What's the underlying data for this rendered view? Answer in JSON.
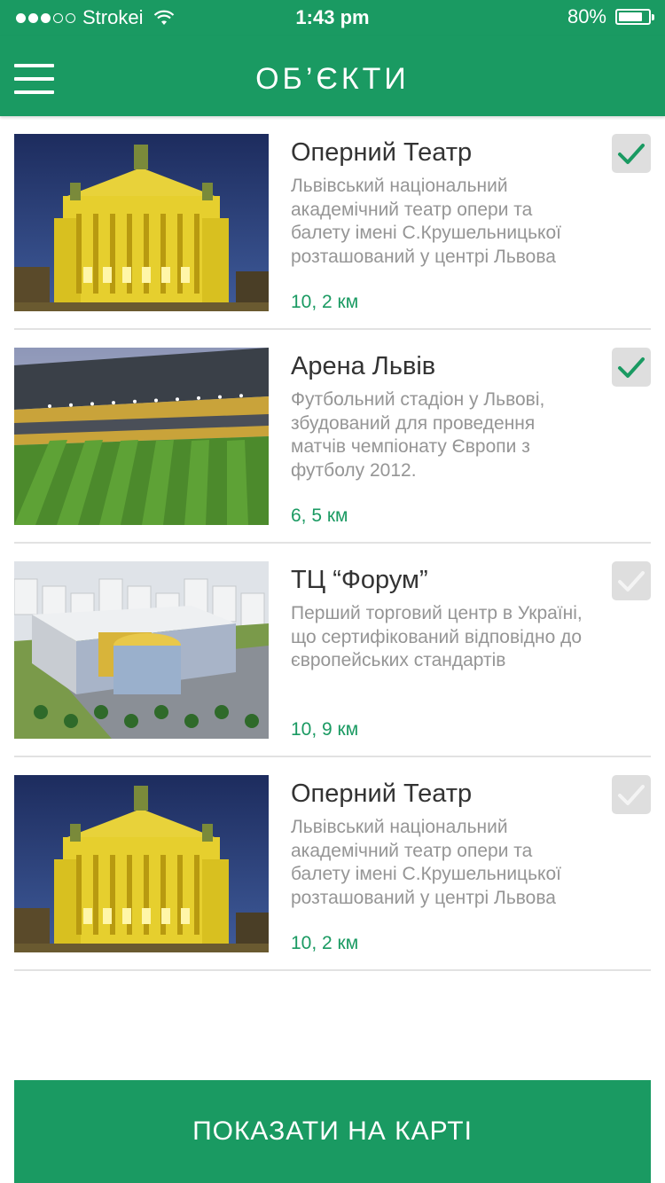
{
  "status": {
    "carrier": "Strokei",
    "time": "1:43 pm",
    "battery": "80%",
    "battery_level": 0.8,
    "signal_bars": 3,
    "signal_total": 5
  },
  "header": {
    "title": "ОБ’ЄКТИ"
  },
  "items": [
    {
      "title": "Оперний Театр",
      "description": "Львівський національний академічний театр опери та балету імені С.Крушельницької розташований у центрі Львова",
      "distance": "10, 2 км",
      "checked": true,
      "image": "opera-theatre"
    },
    {
      "title": "Арена Львів",
      "description": "Футбольний стадіон у Львові, збудований для проведення матчів чемпіонату Європи з футболу 2012.",
      "distance": "6, 5 км",
      "checked": true,
      "image": "arena-stadium"
    },
    {
      "title": "ТЦ “Форум”",
      "description": "Перший торговий центр в Україні, що сертифікований відповідно до європейських стандартів",
      "distance": "10, 9 км",
      "checked": false,
      "image": "forum-mall"
    },
    {
      "title": "Оперний Театр",
      "description": "Львівський національний академічний театр опери та балету імені С.Крушельницької розташований у центрі Львова",
      "distance": "10, 2 км",
      "checked": false,
      "image": "opera-theatre"
    }
  ],
  "footer": {
    "map_button_label": "ПОКАЗАТИ НА КАРТІ"
  },
  "colors": {
    "brand": "#1a9a62",
    "check_active": "#1a9a62",
    "check_inactive": "#f4f4f4",
    "check_bg": "#dedede"
  }
}
